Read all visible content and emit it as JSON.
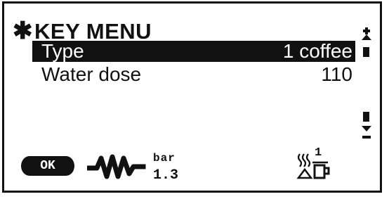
{
  "menu": {
    "star": "✱",
    "title": "KEY MENU",
    "items": [
      {
        "label": "Type",
        "value": "1 coffee",
        "selected": true
      },
      {
        "label": "Water dose",
        "value": "110",
        "selected": false
      }
    ]
  },
  "status": {
    "ok_label": "OK",
    "pressure_unit": "bar",
    "pressure_value": "1.3",
    "cup_count": "1"
  },
  "icons": {
    "ok": "ok-button-icon",
    "pulse": "pressure-pulse-icon",
    "steam_cup": "steam-cup-icon",
    "scroll_up": "scroll-up-icon",
    "scroll_down": "scroll-down-icon"
  },
  "colors": {
    "fg": "#111111",
    "bg": "#ffffff"
  }
}
